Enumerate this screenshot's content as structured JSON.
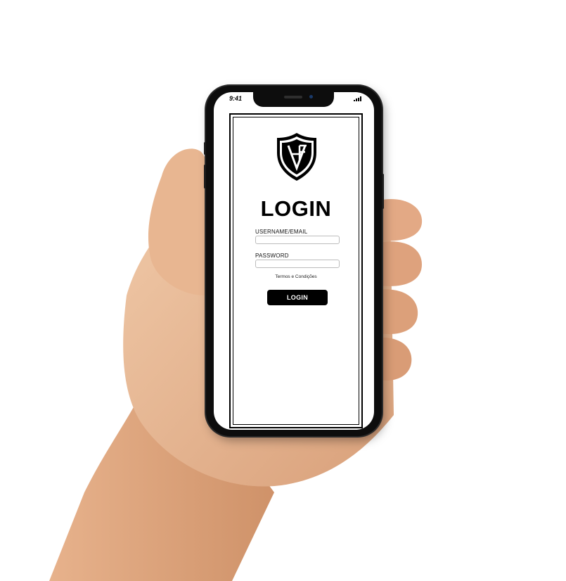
{
  "status_bar": {
    "time": "9:41",
    "signal_icon": "signal-bars-icon"
  },
  "logo": {
    "icon": "shield-crest-icon",
    "monogram": "AF"
  },
  "login": {
    "title": "LOGIN",
    "username_label": "USERNAME/EMAIL",
    "username_value": "",
    "password_label": "PASSWORD",
    "password_value": "",
    "terms_link": "Termos e Condições",
    "submit_label": "LOGIN"
  },
  "colors": {
    "primary": "#000000",
    "background": "#ffffff",
    "input_border": "#bcbcbc"
  }
}
